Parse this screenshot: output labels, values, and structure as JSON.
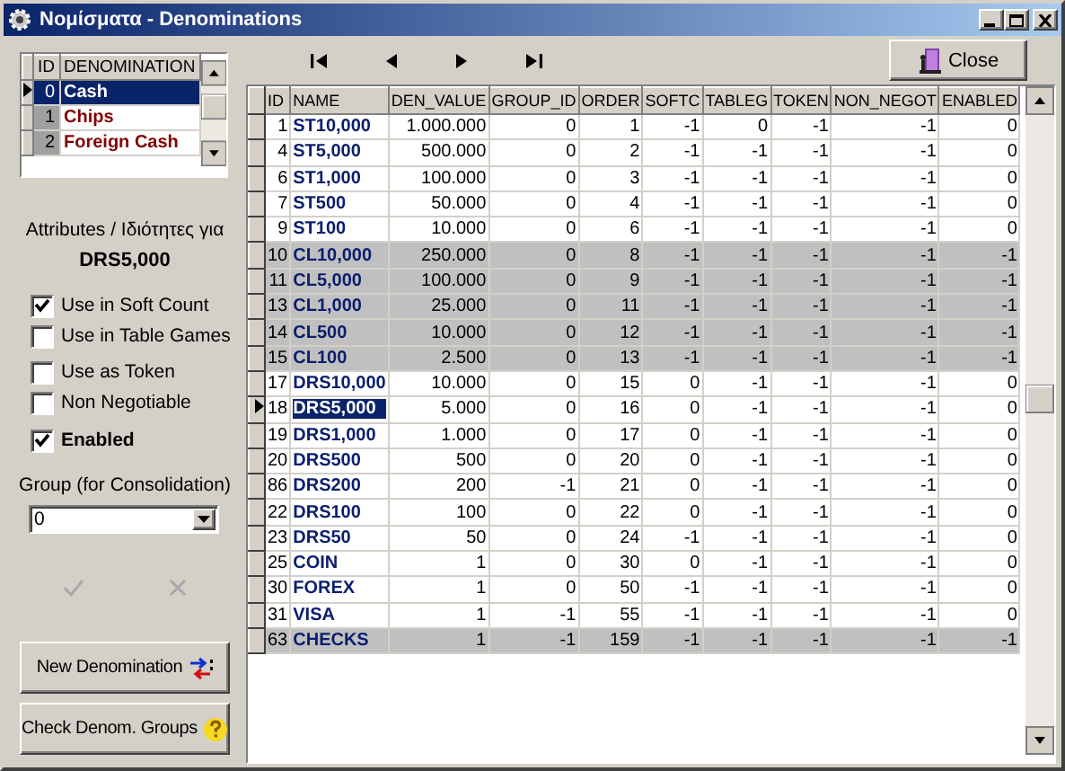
{
  "window": {
    "title": "Νομίσματα - Denominations"
  },
  "denomination_list": {
    "columns": [
      "ID",
      "DENOMINATION"
    ],
    "rows": [
      {
        "id": "0",
        "name": "Cash",
        "selected": true
      },
      {
        "id": "1",
        "name": "Chips",
        "selected": false
      },
      {
        "id": "2",
        "name": "Foreign Cash",
        "selected": false
      }
    ]
  },
  "attributes": {
    "heading": "Attributes / Ιδιότητες για",
    "denomination": "DRS5,000",
    "options": [
      {
        "label": "Use in Soft Count",
        "checked": true,
        "bold": false
      },
      {
        "label": "Use in Table Games",
        "checked": false,
        "bold": false
      },
      {
        "label": "Use as Token",
        "checked": false,
        "bold": false
      },
      {
        "label": "Non Negotiable",
        "checked": false,
        "bold": false
      },
      {
        "label": "Enabled",
        "checked": true,
        "bold": true
      }
    ],
    "group_label": "Group (for Consolidation)",
    "group_value": "0",
    "buttons": [
      {
        "label": "New Denomination",
        "kind": "new"
      },
      {
        "label": "Check Denom. Groups",
        "kind": "help"
      }
    ]
  },
  "toolbar": {
    "close": "Close"
  },
  "grid": {
    "columns": [
      "ID",
      "NAME",
      "DEN_VALUE",
      "GROUP_ID",
      "ORDER",
      "SOFTC",
      "TABLEG",
      "TOKEN",
      "NON_NEGOT",
      "ENABLED"
    ],
    "rows": [
      {
        "cells": [
          "1",
          "ST10,000",
          "1.000.000",
          "0",
          "1",
          "-1",
          "0",
          "-1",
          "-1",
          "0"
        ],
        "highlighted": false,
        "selected": false
      },
      {
        "cells": [
          "4",
          "ST5,000",
          "500.000",
          "0",
          "2",
          "-1",
          "-1",
          "-1",
          "-1",
          "0"
        ],
        "highlighted": false,
        "selected": false
      },
      {
        "cells": [
          "6",
          "ST1,000",
          "100.000",
          "0",
          "3",
          "-1",
          "-1",
          "-1",
          "-1",
          "0"
        ],
        "highlighted": false,
        "selected": false
      },
      {
        "cells": [
          "7",
          "ST500",
          "50.000",
          "0",
          "4",
          "-1",
          "-1",
          "-1",
          "-1",
          "0"
        ],
        "highlighted": false,
        "selected": false
      },
      {
        "cells": [
          "9",
          "ST100",
          "10.000",
          "0",
          "6",
          "-1",
          "-1",
          "-1",
          "-1",
          "0"
        ],
        "highlighted": false,
        "selected": false
      },
      {
        "cells": [
          "10",
          "CL10,000",
          "250.000",
          "0",
          "8",
          "-1",
          "-1",
          "-1",
          "-1",
          "-1"
        ],
        "highlighted": true,
        "selected": false
      },
      {
        "cells": [
          "11",
          "CL5,000",
          "100.000",
          "0",
          "9",
          "-1",
          "-1",
          "-1",
          "-1",
          "-1"
        ],
        "highlighted": true,
        "selected": false
      },
      {
        "cells": [
          "13",
          "CL1,000",
          "25.000",
          "0",
          "11",
          "-1",
          "-1",
          "-1",
          "-1",
          "-1"
        ],
        "highlighted": true,
        "selected": false
      },
      {
        "cells": [
          "14",
          "CL500",
          "10.000",
          "0",
          "12",
          "-1",
          "-1",
          "-1",
          "-1",
          "-1"
        ],
        "highlighted": true,
        "selected": false
      },
      {
        "cells": [
          "15",
          "CL100",
          "2.500",
          "0",
          "13",
          "-1",
          "-1",
          "-1",
          "-1",
          "-1"
        ],
        "highlighted": true,
        "selected": false
      },
      {
        "cells": [
          "17",
          "DRS10,000",
          "10.000",
          "0",
          "15",
          "0",
          "-1",
          "-1",
          "-1",
          "0"
        ],
        "highlighted": false,
        "selected": false
      },
      {
        "cells": [
          "18",
          "DRS5,000",
          "5.000",
          "0",
          "16",
          "0",
          "-1",
          "-1",
          "-1",
          "0"
        ],
        "highlighted": false,
        "selected": true
      },
      {
        "cells": [
          "19",
          "DRS1,000",
          "1.000",
          "0",
          "17",
          "0",
          "-1",
          "-1",
          "-1",
          "0"
        ],
        "highlighted": false,
        "selected": false
      },
      {
        "cells": [
          "20",
          "DRS500",
          "500",
          "0",
          "20",
          "0",
          "-1",
          "-1",
          "-1",
          "0"
        ],
        "highlighted": false,
        "selected": false
      },
      {
        "cells": [
          "86",
          "DRS200",
          "200",
          "-1",
          "21",
          "0",
          "-1",
          "-1",
          "-1",
          "0"
        ],
        "highlighted": false,
        "selected": false
      },
      {
        "cells": [
          "22",
          "DRS100",
          "100",
          "0",
          "22",
          "0",
          "-1",
          "-1",
          "-1",
          "0"
        ],
        "highlighted": false,
        "selected": false
      },
      {
        "cells": [
          "23",
          "DRS50",
          "50",
          "0",
          "24",
          "-1",
          "-1",
          "-1",
          "-1",
          "0"
        ],
        "highlighted": false,
        "selected": false
      },
      {
        "cells": [
          "25",
          "COIN",
          "1",
          "0",
          "30",
          "0",
          "-1",
          "-1",
          "-1",
          "0"
        ],
        "highlighted": false,
        "selected": false
      },
      {
        "cells": [
          "30",
          "FOREX",
          "1",
          "0",
          "50",
          "-1",
          "-1",
          "-1",
          "-1",
          "0"
        ],
        "highlighted": false,
        "selected": false
      },
      {
        "cells": [
          "31",
          "VISA",
          "1",
          "-1",
          "55",
          "-1",
          "-1",
          "-1",
          "-1",
          "0"
        ],
        "highlighted": false,
        "selected": false
      },
      {
        "cells": [
          "63",
          "CHECKS",
          "1",
          "-1",
          "159",
          "-1",
          "-1",
          "-1",
          "-1",
          "-1"
        ],
        "highlighted": true,
        "selected": false
      }
    ]
  }
}
